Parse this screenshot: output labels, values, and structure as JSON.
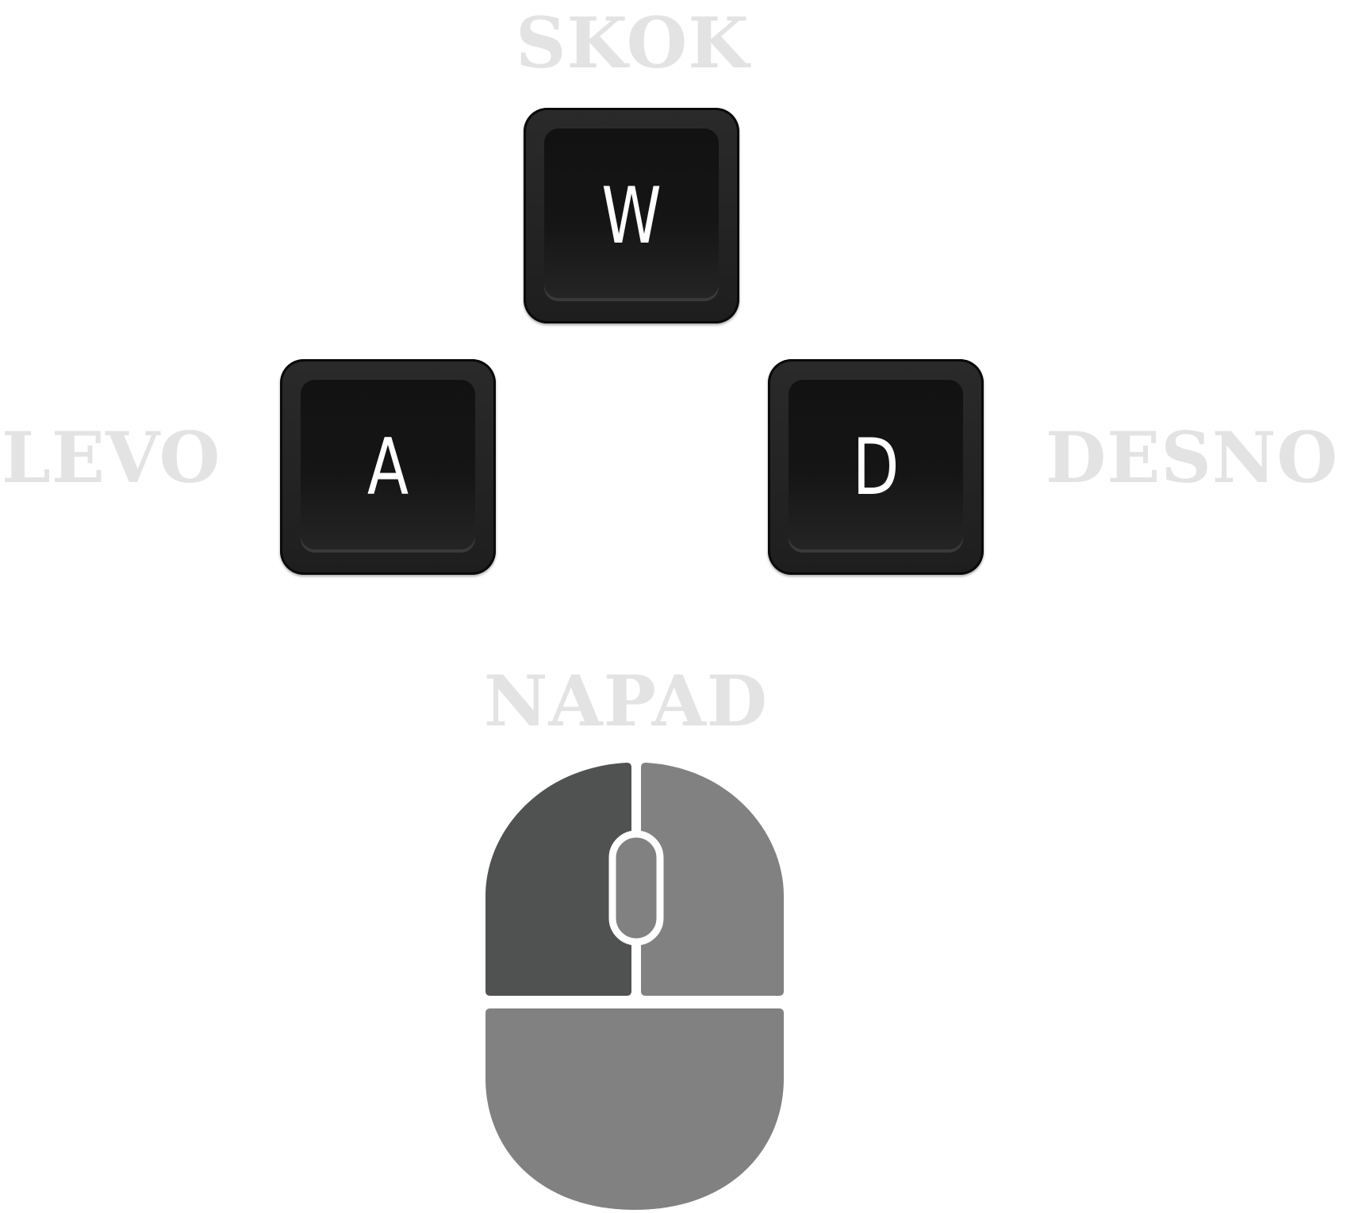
{
  "controls": {
    "jump_label": "SKOK",
    "left_label": "LEVO",
    "right_label": "DESNO",
    "attack_label": "NAPAD",
    "keys": {
      "w": "W",
      "a": "A",
      "d": "D"
    }
  },
  "icons": {
    "mouse": "mouse-icon"
  },
  "colors": {
    "label": "#e3e3e3",
    "key_body": "#1e1e1e",
    "key_glyph": "#ffffff",
    "mouse_left_button": "#505251",
    "mouse_right_button": "#808180",
    "mouse_body": "#808180"
  }
}
